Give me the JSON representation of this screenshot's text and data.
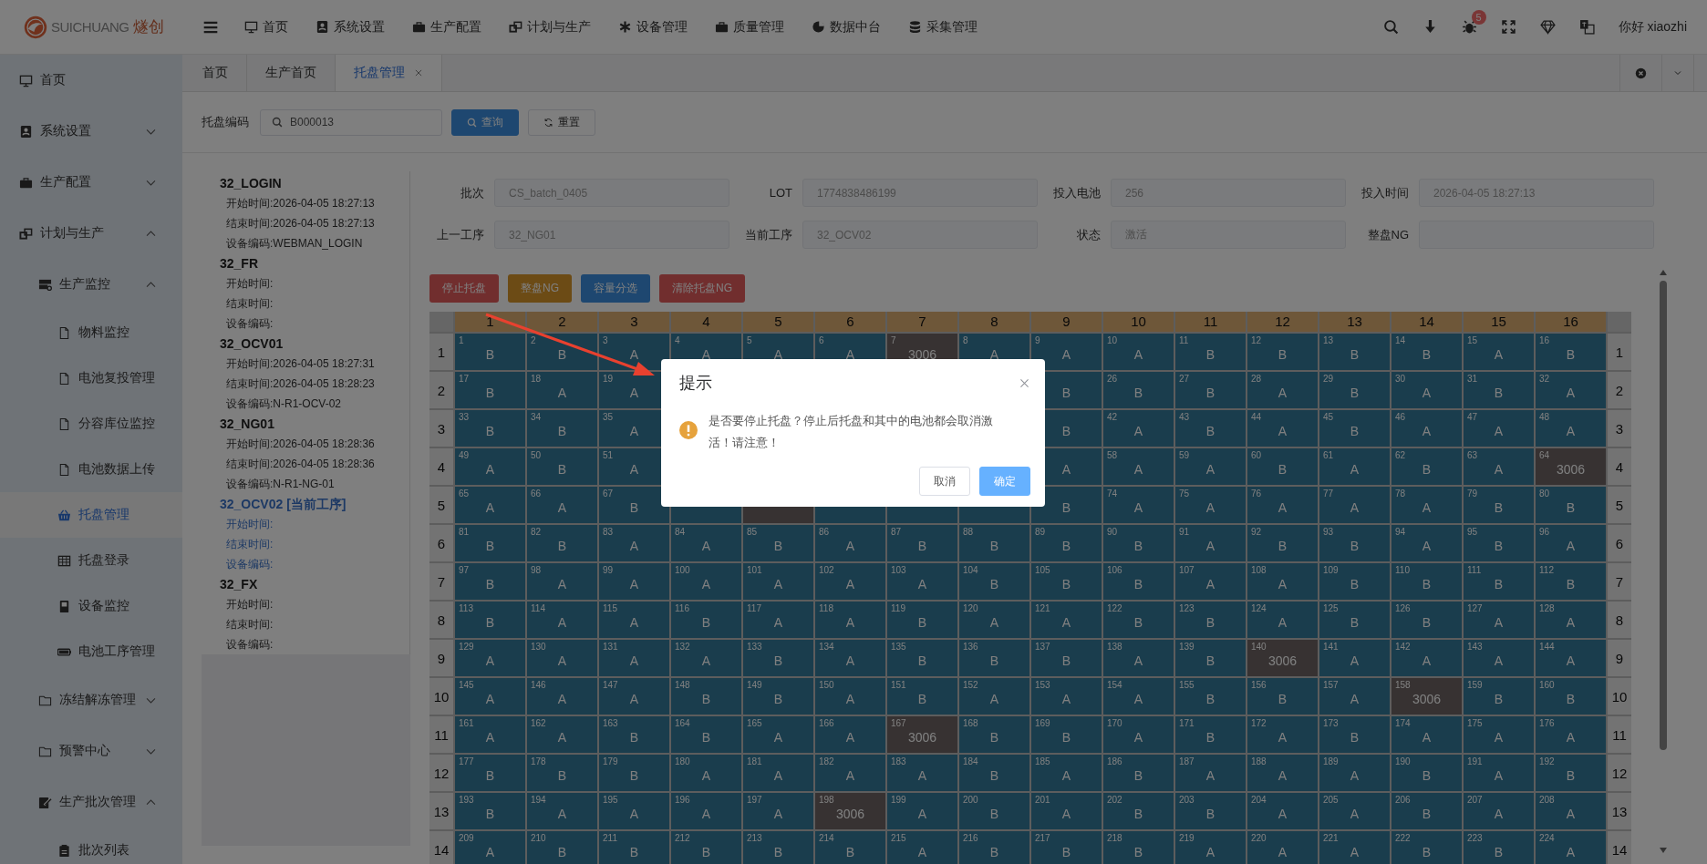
{
  "header": {
    "brand": "SUICHUANG",
    "brand_cn": "燧创",
    "nav": [
      {
        "label": "首页"
      },
      {
        "label": "系统设置"
      },
      {
        "label": "生产配置"
      },
      {
        "label": "计划与生产"
      },
      {
        "label": "设备管理"
      },
      {
        "label": "质量管理"
      },
      {
        "label": "数据中台"
      },
      {
        "label": "采集管理"
      }
    ],
    "badge": "5",
    "greeting": "你好 xiaozhi"
  },
  "sidebar": {
    "items": [
      {
        "label": "首页",
        "selected": false
      },
      {
        "label": "系统设置",
        "selected": false,
        "expanded": false
      },
      {
        "label": "生产配置",
        "selected": false,
        "expanded": false
      },
      {
        "label": "计划与生产",
        "selected": false,
        "expanded": true,
        "children": [
          {
            "label": "生产监控",
            "selected": false,
            "expanded": true,
            "children": [
              {
                "label": "物料监控",
                "selected": false
              },
              {
                "label": "电池复投管理",
                "selected": false
              },
              {
                "label": "分容库位监控",
                "selected": false
              },
              {
                "label": "电池数据上传",
                "selected": false
              },
              {
                "label": "托盘管理",
                "selected": true
              },
              {
                "label": "托盘登录",
                "selected": false
              },
              {
                "label": "设备监控",
                "selected": false
              },
              {
                "label": "电池工序管理",
                "selected": false
              }
            ]
          },
          {
            "label": "冻结解冻管理",
            "selected": false,
            "expanded": false
          },
          {
            "label": "预警中心",
            "selected": false,
            "expanded": false
          },
          {
            "label": "生产批次管理",
            "selected": false,
            "expanded": true,
            "children": [
              {
                "label": "批次列表",
                "selected": false
              }
            ]
          }
        ]
      }
    ]
  },
  "tabs": [
    {
      "label": "首页",
      "selected": false
    },
    {
      "label": "生产首页",
      "selected": false
    },
    {
      "label": "托盘管理",
      "selected": true,
      "closable": true
    }
  ],
  "search": {
    "label": "托盘编码",
    "value": "B000013",
    "buttons": [
      {
        "label": "查询",
        "kind": "primary"
      },
      {
        "label": "重置",
        "kind": "default"
      }
    ]
  },
  "processes": [
    {
      "name": "32_LOGIN",
      "current": false,
      "lines": [
        "开始时间:2026-04-05 18:27:13",
        "结束时间:2026-04-05 18:27:13",
        "设备编码:WEBMAN_LOGIN"
      ]
    },
    {
      "name": "32_FR",
      "current": false,
      "lines": [
        "开始时间:",
        "结束时间:",
        "设备编码:"
      ]
    },
    {
      "name": "32_OCV01",
      "current": false,
      "lines": [
        "开始时间:2026-04-05 18:27:31",
        "结束时间:2026-04-05 18:28:23",
        "设备编码:N-R1-OCV-02"
      ]
    },
    {
      "name": "32_NG01",
      "current": false,
      "lines": [
        "开始时间:2026-04-05 18:28:36",
        "结束时间:2026-04-05 18:28:36",
        "设备编码:N-R1-NG-01"
      ]
    },
    {
      "name": "32_OCV02 [当前工序]",
      "current": true,
      "lines": [
        "开始时间:",
        "结束时间:",
        "设备编码:"
      ]
    },
    {
      "name": "32_FX",
      "current": false,
      "lines": [
        "开始时间:",
        "结束时间:",
        "设备编码:"
      ]
    }
  ],
  "fields": [
    {
      "label": "批次",
      "value": "CS_batch_0405"
    },
    {
      "label": "LOT",
      "value": "1774838486199"
    },
    {
      "label": "投入电池",
      "value": "256"
    },
    {
      "label": "投入时间",
      "value": "2026-04-05 18:27:13"
    },
    {
      "label": "上一工序",
      "value": "32_NG01"
    },
    {
      "label": "当前工序",
      "value": "32_OCV02"
    },
    {
      "label": "状态",
      "value": "激活"
    },
    {
      "label": "整盘NG"
    }
  ],
  "actions": [
    {
      "label": "停止托盘",
      "kind": "danger"
    },
    {
      "label": "整盘NG",
      "kind": "warning"
    },
    {
      "label": "容量分选",
      "kind": "primary"
    },
    {
      "label": "清除托盘NG",
      "kind": "danger"
    }
  ],
  "tray": {
    "columns": [
      "1",
      "2",
      "3",
      "4",
      "5",
      "6",
      "7",
      "8",
      "9",
      "10",
      "11",
      "12",
      "13",
      "14",
      "15",
      "16"
    ],
    "rows": [
      {
        "labels": [
          "1",
          "1"
        ],
        "cells": [
          {
            "kind": "cell",
            "no": "1",
            "grade": "B"
          },
          {
            "kind": "cell",
            "no": "2",
            "grade": "B"
          },
          {
            "kind": "cell",
            "no": "3",
            "grade": "A"
          },
          {
            "kind": "cell",
            "no": "4",
            "grade": "A"
          },
          {
            "kind": "cell",
            "no": "5",
            "grade": "A"
          },
          {
            "kind": "cell",
            "no": "6",
            "grade": "A"
          },
          {
            "kind": "ng",
            "no": "7",
            "code": "3006"
          },
          {
            "kind": "cell",
            "no": "8",
            "grade": "A"
          },
          {
            "kind": "cell",
            "no": "9",
            "grade": "A"
          },
          {
            "kind": "cell",
            "no": "10",
            "grade": "A"
          },
          {
            "kind": "cell",
            "no": "11",
            "grade": "B"
          },
          {
            "kind": "cell",
            "no": "12",
            "grade": "B"
          },
          {
            "kind": "cell",
            "no": "13",
            "grade": "B"
          },
          {
            "kind": "cell",
            "no": "14",
            "grade": "B"
          },
          {
            "kind": "cell",
            "no": "15",
            "grade": "A"
          },
          {
            "kind": "cell",
            "no": "16",
            "grade": "B"
          }
        ]
      },
      {
        "labels": [
          "2",
          "2"
        ],
        "cells": [
          {
            "kind": "cell",
            "no": "17",
            "grade": "B"
          },
          {
            "kind": "cell",
            "no": "18",
            "grade": "A"
          },
          {
            "kind": "cell",
            "no": "19",
            "grade": "A"
          },
          {
            "kind": "hidden"
          },
          {
            "kind": "hidden"
          },
          {
            "kind": "hidden"
          },
          {
            "kind": "hidden"
          },
          {
            "kind": "hidden"
          },
          {
            "kind": "partial",
            "grade": "B"
          },
          {
            "kind": "cell",
            "no": "26",
            "grade": "B"
          },
          {
            "kind": "cell",
            "no": "27",
            "grade": "B"
          },
          {
            "kind": "cell",
            "no": "28",
            "grade": "A"
          },
          {
            "kind": "cell",
            "no": "29",
            "grade": "B"
          },
          {
            "kind": "cell",
            "no": "30",
            "grade": "A"
          },
          {
            "kind": "cell",
            "no": "31",
            "grade": "B"
          },
          {
            "kind": "cell",
            "no": "32",
            "grade": "A"
          }
        ]
      },
      {
        "labels": [
          "3",
          "3"
        ],
        "cells": [
          {
            "kind": "cell",
            "no": "33",
            "grade": "B"
          },
          {
            "kind": "cell",
            "no": "34",
            "grade": "B"
          },
          {
            "kind": "cell",
            "no": "35",
            "grade": "A"
          },
          {
            "kind": "hidden"
          },
          {
            "kind": "hidden"
          },
          {
            "kind": "hidden"
          },
          {
            "kind": "hidden"
          },
          {
            "kind": "hidden"
          },
          {
            "kind": "partial",
            "grade": "B"
          },
          {
            "kind": "cell",
            "no": "42",
            "grade": "A"
          },
          {
            "kind": "cell",
            "no": "43",
            "grade": "B"
          },
          {
            "kind": "cell",
            "no": "44",
            "grade": "A"
          },
          {
            "kind": "cell",
            "no": "45",
            "grade": "B"
          },
          {
            "kind": "cell",
            "no": "46",
            "grade": "A"
          },
          {
            "kind": "cell",
            "no": "47",
            "grade": "A"
          },
          {
            "kind": "cell",
            "no": "48",
            "grade": "A"
          }
        ]
      },
      {
        "labels": [
          "4",
          "4"
        ],
        "cells": [
          {
            "kind": "cell",
            "no": "49",
            "grade": "A"
          },
          {
            "kind": "cell",
            "no": "50",
            "grade": "B"
          },
          {
            "kind": "cell",
            "no": "51",
            "grade": "A"
          },
          {
            "kind": "hidden"
          },
          {
            "kind": "hidden"
          },
          {
            "kind": "hidden"
          },
          {
            "kind": "hidden"
          },
          {
            "kind": "hidden"
          },
          {
            "kind": "partial",
            "grade": "A"
          },
          {
            "kind": "cell",
            "no": "58",
            "grade": "A"
          },
          {
            "kind": "cell",
            "no": "59",
            "grade": "A"
          },
          {
            "kind": "cell",
            "no": "60",
            "grade": "B"
          },
          {
            "kind": "cell",
            "no": "61",
            "grade": "A"
          },
          {
            "kind": "cell",
            "no": "62",
            "grade": "B"
          },
          {
            "kind": "cell",
            "no": "63",
            "grade": "A"
          },
          {
            "kind": "ng",
            "no": "64",
            "code": "3006"
          }
        ]
      },
      {
        "labels": [
          "5",
          "5"
        ],
        "cells": [
          {
            "kind": "cell",
            "no": "65",
            "grade": "A"
          },
          {
            "kind": "cell",
            "no": "66",
            "grade": "A"
          },
          {
            "kind": "cell",
            "no": "67",
            "grade": "B"
          },
          {
            "kind": "covered"
          },
          {
            "kind": "covered_ng"
          },
          {
            "kind": "covered"
          },
          {
            "kind": "covered"
          },
          {
            "kind": "covered"
          },
          {
            "kind": "partial",
            "grade": "B"
          },
          {
            "kind": "cell",
            "no": "74",
            "grade": "A"
          },
          {
            "kind": "cell",
            "no": "75",
            "grade": "A"
          },
          {
            "kind": "cell",
            "no": "76",
            "grade": "A"
          },
          {
            "kind": "cell",
            "no": "77",
            "grade": "A"
          },
          {
            "kind": "cell",
            "no": "78",
            "grade": "A"
          },
          {
            "kind": "cell",
            "no": "79",
            "grade": "B"
          },
          {
            "kind": "cell",
            "no": "80",
            "grade": "B"
          }
        ]
      },
      {
        "labels": [
          "6",
          "6"
        ],
        "cells": [
          {
            "kind": "cell",
            "no": "81",
            "grade": "B"
          },
          {
            "kind": "cell",
            "no": "82",
            "grade": "B"
          },
          {
            "kind": "cell",
            "no": "83",
            "grade": "A"
          },
          {
            "kind": "cell",
            "no": "84",
            "grade": "A"
          },
          {
            "kind": "cell",
            "no": "85",
            "grade": "B"
          },
          {
            "kind": "cell",
            "no": "86",
            "grade": "A"
          },
          {
            "kind": "cell",
            "no": "87",
            "grade": "B"
          },
          {
            "kind": "cell",
            "no": "88",
            "grade": "B"
          },
          {
            "kind": "cell",
            "no": "89",
            "grade": "B"
          },
          {
            "kind": "cell",
            "no": "90",
            "grade": "B"
          },
          {
            "kind": "cell",
            "no": "91",
            "grade": "A"
          },
          {
            "kind": "cell",
            "no": "92",
            "grade": "B"
          },
          {
            "kind": "cell",
            "no": "93",
            "grade": "B"
          },
          {
            "kind": "cell",
            "no": "94",
            "grade": "A"
          },
          {
            "kind": "cell",
            "no": "95",
            "grade": "B"
          },
          {
            "kind": "cell",
            "no": "96",
            "grade": "A"
          }
        ]
      },
      {
        "labels": [
          "7",
          "7"
        ],
        "cells": [
          {
            "kind": "cell",
            "no": "97",
            "grade": "B"
          },
          {
            "kind": "cell",
            "no": "98",
            "grade": "A"
          },
          {
            "kind": "cell",
            "no": "99",
            "grade": "A"
          },
          {
            "kind": "cell",
            "no": "100",
            "grade": "A"
          },
          {
            "kind": "cell",
            "no": "101",
            "grade": "A"
          },
          {
            "kind": "cell",
            "no": "102",
            "grade": "A"
          },
          {
            "kind": "cell",
            "no": "103",
            "grade": "A"
          },
          {
            "kind": "cell",
            "no": "104",
            "grade": "B"
          },
          {
            "kind": "cell",
            "no": "105",
            "grade": "B"
          },
          {
            "kind": "cell",
            "no": "106",
            "grade": "B"
          },
          {
            "kind": "cell",
            "no": "107",
            "grade": "A"
          },
          {
            "kind": "cell",
            "no": "108",
            "grade": "A"
          },
          {
            "kind": "cell",
            "no": "109",
            "grade": "B"
          },
          {
            "kind": "cell",
            "no": "110",
            "grade": "B"
          },
          {
            "kind": "cell",
            "no": "111",
            "grade": "B"
          },
          {
            "kind": "cell",
            "no": "112",
            "grade": "B"
          }
        ]
      },
      {
        "labels": [
          "8",
          "8"
        ],
        "cells": [
          {
            "kind": "cell",
            "no": "113",
            "grade": "B"
          },
          {
            "kind": "cell",
            "no": "114",
            "grade": "A"
          },
          {
            "kind": "cell",
            "no": "115",
            "grade": "A"
          },
          {
            "kind": "cell",
            "no": "116",
            "grade": "B"
          },
          {
            "kind": "cell",
            "no": "117",
            "grade": "A"
          },
          {
            "kind": "cell",
            "no": "118",
            "grade": "A"
          },
          {
            "kind": "cell",
            "no": "119",
            "grade": "B"
          },
          {
            "kind": "cell",
            "no": "120",
            "grade": "A"
          },
          {
            "kind": "cell",
            "no": "121",
            "grade": "A"
          },
          {
            "kind": "cell",
            "no": "122",
            "grade": "B"
          },
          {
            "kind": "cell",
            "no": "123",
            "grade": "B"
          },
          {
            "kind": "cell",
            "no": "124",
            "grade": "A"
          },
          {
            "kind": "cell",
            "no": "125",
            "grade": "B"
          },
          {
            "kind": "cell",
            "no": "126",
            "grade": "B"
          },
          {
            "kind": "cell",
            "no": "127",
            "grade": "A"
          },
          {
            "kind": "cell",
            "no": "128",
            "grade": "A"
          }
        ]
      },
      {
        "labels": [
          "9",
          "9"
        ],
        "cells": [
          {
            "kind": "cell",
            "no": "129",
            "grade": "A"
          },
          {
            "kind": "cell",
            "no": "130",
            "grade": "A"
          },
          {
            "kind": "cell",
            "no": "131",
            "grade": "A"
          },
          {
            "kind": "cell",
            "no": "132",
            "grade": "A"
          },
          {
            "kind": "cell",
            "no": "133",
            "grade": "B"
          },
          {
            "kind": "cell",
            "no": "134",
            "grade": "A"
          },
          {
            "kind": "cell",
            "no": "135",
            "grade": "B"
          },
          {
            "kind": "cell",
            "no": "136",
            "grade": "B"
          },
          {
            "kind": "cell",
            "no": "137",
            "grade": "B"
          },
          {
            "kind": "cell",
            "no": "138",
            "grade": "A"
          },
          {
            "kind": "cell",
            "no": "139",
            "grade": "B"
          },
          {
            "kind": "ng",
            "no": "140",
            "code": "3006"
          },
          {
            "kind": "cell",
            "no": "141",
            "grade": "A"
          },
          {
            "kind": "cell",
            "no": "142",
            "grade": "A"
          },
          {
            "kind": "cell",
            "no": "143",
            "grade": "A"
          },
          {
            "kind": "cell",
            "no": "144",
            "grade": "A"
          }
        ]
      },
      {
        "labels": [
          "10",
          "10"
        ],
        "cells": [
          {
            "kind": "cell",
            "no": "145",
            "grade": "A"
          },
          {
            "kind": "cell",
            "no": "146",
            "grade": "A"
          },
          {
            "kind": "cell",
            "no": "147",
            "grade": "A"
          },
          {
            "kind": "cell",
            "no": "148",
            "grade": "B"
          },
          {
            "kind": "cell",
            "no": "149",
            "grade": "B"
          },
          {
            "kind": "cell",
            "no": "150",
            "grade": "A"
          },
          {
            "kind": "cell",
            "no": "151",
            "grade": "B"
          },
          {
            "kind": "cell",
            "no": "152",
            "grade": "A"
          },
          {
            "kind": "cell",
            "no": "153",
            "grade": "A"
          },
          {
            "kind": "cell",
            "no": "154",
            "grade": "A"
          },
          {
            "kind": "cell",
            "no": "155",
            "grade": "B"
          },
          {
            "kind": "cell",
            "no": "156",
            "grade": "B"
          },
          {
            "kind": "cell",
            "no": "157",
            "grade": "A"
          },
          {
            "kind": "ng",
            "no": "158",
            "code": "3006"
          },
          {
            "kind": "cell",
            "no": "159",
            "grade": "B"
          },
          {
            "kind": "cell",
            "no": "160",
            "grade": "B"
          }
        ]
      },
      {
        "labels": [
          "11",
          "11"
        ],
        "cells": [
          {
            "kind": "cell",
            "no": "161",
            "grade": "A"
          },
          {
            "kind": "cell",
            "no": "162",
            "grade": "A"
          },
          {
            "kind": "cell",
            "no": "163",
            "grade": "B"
          },
          {
            "kind": "cell",
            "no": "164",
            "grade": "B"
          },
          {
            "kind": "cell",
            "no": "165",
            "grade": "A"
          },
          {
            "kind": "cell",
            "no": "166",
            "grade": "A"
          },
          {
            "kind": "ng",
            "no": "167",
            "code": "3006"
          },
          {
            "kind": "cell",
            "no": "168",
            "grade": "B"
          },
          {
            "kind": "cell",
            "no": "169",
            "grade": "B"
          },
          {
            "kind": "cell",
            "no": "170",
            "grade": "A"
          },
          {
            "kind": "cell",
            "no": "171",
            "grade": "B"
          },
          {
            "kind": "cell",
            "no": "172",
            "grade": "A"
          },
          {
            "kind": "cell",
            "no": "173",
            "grade": "B"
          },
          {
            "kind": "cell",
            "no": "174",
            "grade": "A"
          },
          {
            "kind": "cell",
            "no": "175",
            "grade": "A"
          },
          {
            "kind": "cell",
            "no": "176",
            "grade": "A"
          }
        ]
      },
      {
        "labels": [
          "12",
          "12"
        ],
        "cells": [
          {
            "kind": "cell",
            "no": "177",
            "grade": "B"
          },
          {
            "kind": "cell",
            "no": "178",
            "grade": "B"
          },
          {
            "kind": "cell",
            "no": "179",
            "grade": "B"
          },
          {
            "kind": "cell",
            "no": "180",
            "grade": "A"
          },
          {
            "kind": "cell",
            "no": "181",
            "grade": "A"
          },
          {
            "kind": "cell",
            "no": "182",
            "grade": "A"
          },
          {
            "kind": "cell",
            "no": "183",
            "grade": "A"
          },
          {
            "kind": "cell",
            "no": "184",
            "grade": "B"
          },
          {
            "kind": "cell",
            "no": "185",
            "grade": "A"
          },
          {
            "kind": "cell",
            "no": "186",
            "grade": "B"
          },
          {
            "kind": "cell",
            "no": "187",
            "grade": "A"
          },
          {
            "kind": "cell",
            "no": "188",
            "grade": "A"
          },
          {
            "kind": "cell",
            "no": "189",
            "grade": "A"
          },
          {
            "kind": "cell",
            "no": "190",
            "grade": "B"
          },
          {
            "kind": "cell",
            "no": "191",
            "grade": "A"
          },
          {
            "kind": "cell",
            "no": "192",
            "grade": "B"
          }
        ]
      },
      {
        "labels": [
          "13",
          "13"
        ],
        "cells": [
          {
            "kind": "cell",
            "no": "193",
            "grade": "B"
          },
          {
            "kind": "cell",
            "no": "194",
            "grade": "A"
          },
          {
            "kind": "cell",
            "no": "195",
            "grade": "A"
          },
          {
            "kind": "cell",
            "no": "196",
            "grade": "A"
          },
          {
            "kind": "cell",
            "no": "197",
            "grade": "A"
          },
          {
            "kind": "ng",
            "no": "198",
            "code": "3006"
          },
          {
            "kind": "cell",
            "no": "199",
            "grade": "A"
          },
          {
            "kind": "cell",
            "no": "200",
            "grade": "B"
          },
          {
            "kind": "cell",
            "no": "201",
            "grade": "A"
          },
          {
            "kind": "cell",
            "no": "202",
            "grade": "B"
          },
          {
            "kind": "cell",
            "no": "203",
            "grade": "B"
          },
          {
            "kind": "cell",
            "no": "204",
            "grade": "A"
          },
          {
            "kind": "cell",
            "no": "205",
            "grade": "A"
          },
          {
            "kind": "cell",
            "no": "206",
            "grade": "B"
          },
          {
            "kind": "cell",
            "no": "207",
            "grade": "A"
          },
          {
            "kind": "cell",
            "no": "208",
            "grade": "A"
          }
        ]
      },
      {
        "labels": [
          "14",
          "14"
        ],
        "cells": [
          {
            "kind": "cell",
            "no": "209",
            "grade": "A"
          },
          {
            "kind": "cell",
            "no": "210",
            "grade": "B"
          },
          {
            "kind": "cell",
            "no": "211",
            "grade": "B"
          },
          {
            "kind": "cell",
            "no": "212",
            "grade": "B"
          },
          {
            "kind": "cell",
            "no": "213",
            "grade": "B"
          },
          {
            "kind": "cell",
            "no": "214",
            "grade": "B"
          },
          {
            "kind": "cell",
            "no": "215",
            "grade": "A"
          },
          {
            "kind": "cell",
            "no": "216",
            "grade": "B"
          },
          {
            "kind": "cell",
            "no": "217",
            "grade": "B"
          },
          {
            "kind": "cell",
            "no": "218",
            "grade": "B"
          },
          {
            "kind": "cell",
            "no": "219",
            "grade": "A"
          },
          {
            "kind": "cell",
            "no": "220",
            "grade": "A"
          },
          {
            "kind": "cell",
            "no": "221",
            "grade": "A"
          },
          {
            "kind": "cell",
            "no": "222",
            "grade": "B"
          },
          {
            "kind": "cell",
            "no": "223",
            "grade": "B"
          },
          {
            "kind": "cell",
            "no": "224",
            "grade": "A"
          }
        ]
      }
    ]
  },
  "dialog": {
    "title": "提示",
    "message": "是否要停止托盘？停止后托盘和其中的电池都会取消激活！请注意！",
    "buttons": [
      {
        "label": "取消",
        "kind": "default"
      },
      {
        "label": "确定",
        "kind": "primary"
      }
    ]
  }
}
